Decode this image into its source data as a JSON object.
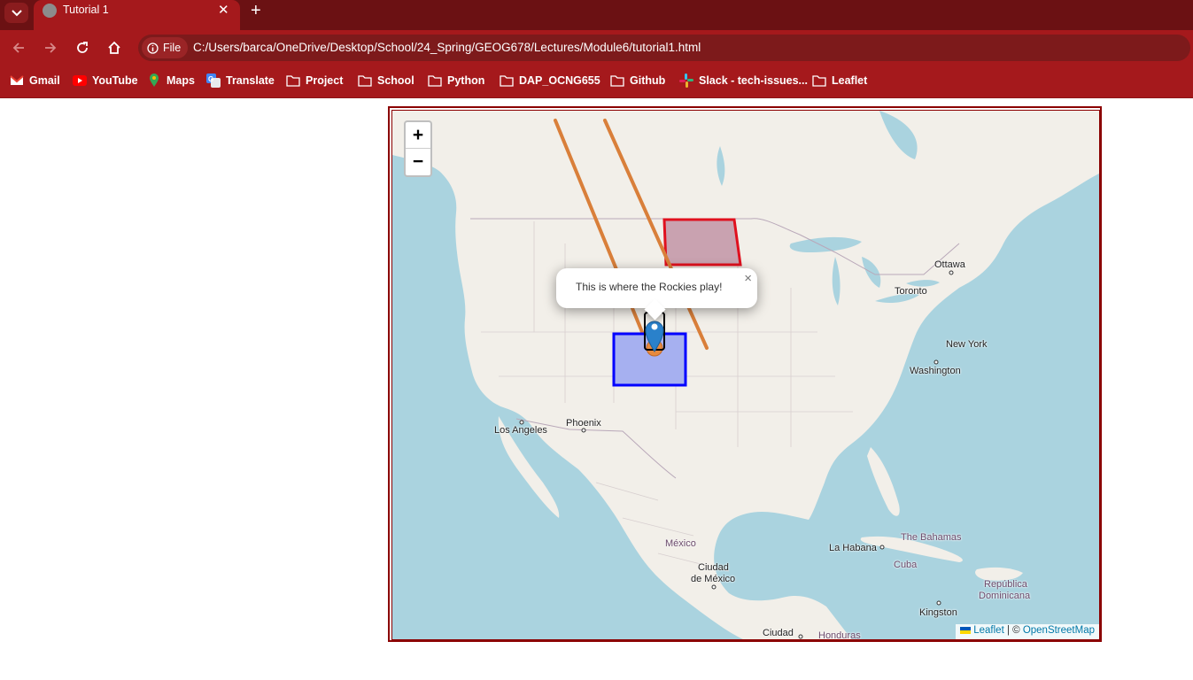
{
  "browser": {
    "tab_title": "Tutorial 1",
    "url_chip": "File",
    "url": "C:/Users/barca/OneDrive/Desktop/School/24_Spring/GEOG678/Lectures/Module6/tutorial1.html",
    "bookmarks": [
      {
        "label": "Gmail",
        "icon": "gmail-icon"
      },
      {
        "label": "YouTube",
        "icon": "youtube-icon"
      },
      {
        "label": "Maps",
        "icon": "maps-icon"
      },
      {
        "label": "Translate",
        "icon": "translate-icon"
      },
      {
        "label": "Project",
        "icon": "folder-icon"
      },
      {
        "label": "School",
        "icon": "folder-icon"
      },
      {
        "label": "Python",
        "icon": "folder-icon"
      },
      {
        "label": "DAP_OCNG655",
        "icon": "folder-icon"
      },
      {
        "label": "Github",
        "icon": "folder-icon"
      },
      {
        "label": "Slack - tech-issues...",
        "icon": "slack-icon"
      },
      {
        "label": "Leaflet",
        "icon": "folder-icon"
      }
    ]
  },
  "map": {
    "zoom_in": "+",
    "zoom_out": "−",
    "popup_text": "This is where the Rockies play!",
    "popup_close": "×",
    "attribution": {
      "leaflet": "Leaflet",
      "separator": " | © ",
      "osm": "OpenStreetMap"
    },
    "labels": {
      "ottawa": "Ottawa",
      "toronto": "Toronto",
      "new_york": "New York",
      "washington": "Washington",
      "los_angeles": "Los Angeles",
      "phoenix": "Phoenix",
      "mexico": "México",
      "ciudad_mexico_1": "Ciudad",
      "ciudad_mexico_2": "de México",
      "la_habana": "La Habana",
      "bahamas": "The Bahamas",
      "cuba": "Cuba",
      "republica_1": "República",
      "republica_2": "Dominicana",
      "kingston": "Kingston",
      "honduras": "Honduras",
      "ciudad_bottom": "Ciudad"
    },
    "colors": {
      "polyline": "#d97f3a",
      "polygon_stroke": "#e0101e",
      "polygon_fill": "#c9a2b0",
      "rect_stroke": "#0000ff",
      "rect_fill": "#a6b0f0",
      "marker": "#2a81cb",
      "circle": "#e88a3e"
    }
  }
}
